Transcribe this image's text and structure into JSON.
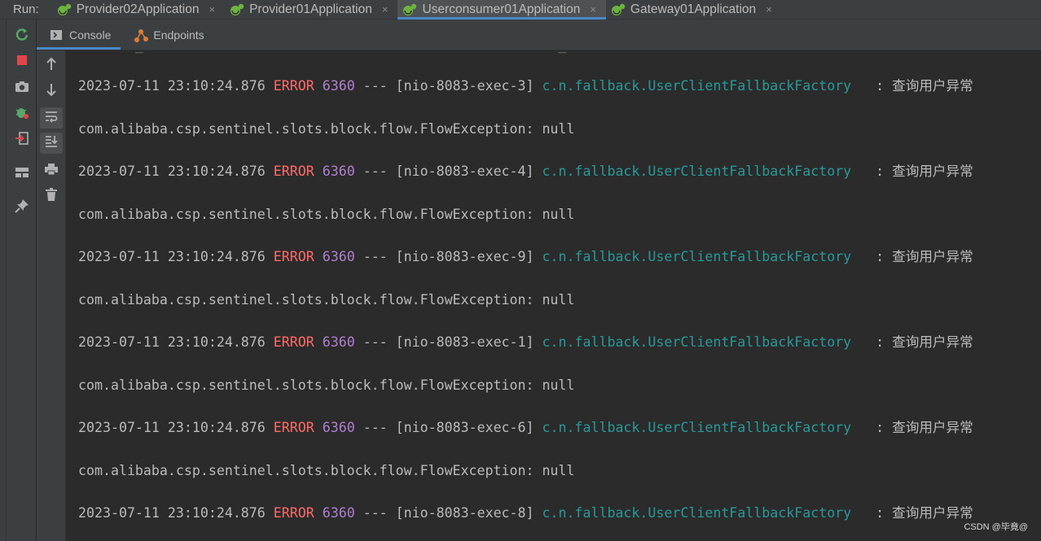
{
  "run_bar": {
    "label": "Run:",
    "tabs": [
      {
        "name": "Provider02Application",
        "active": false
      },
      {
        "name": "Provider01Application",
        "active": false
      },
      {
        "name": "Userconsumer01Application",
        "active": true
      },
      {
        "name": "Gateway01Application",
        "active": false
      }
    ],
    "close_glyph": "×"
  },
  "console_tabs": [
    {
      "label": "Console",
      "icon": "console-icon",
      "active": true
    },
    {
      "label": "Endpoints",
      "icon": "endpoints-icon",
      "active": false
    }
  ],
  "left_toolbar_icons": [
    "rerun-icon",
    "stop-icon",
    "camera-icon",
    "debug-icon",
    "exit-icon",
    "layout-icon",
    "pin-icon"
  ],
  "console_toolbar_icons": [
    "up-arrow-icon",
    "down-arrow-icon",
    "soft-wrap-icon",
    "scroll-to-end-icon",
    "print-icon",
    "trash-icon"
  ],
  "log": {
    "entries": [
      {
        "datetime": "2023-07-11 23:10:24.876",
        "level": "ERROR",
        "pid": "6360",
        "sep": "---",
        "thread": "[nio-8083-exec-3]",
        "logger": "c.n.fallback.UserClientFallbackFactory",
        "message": ": 查询用户异常",
        "exception": "com.alibaba.csp.sentinel.slots.block.flow.FlowException: null"
      },
      {
        "datetime": "2023-07-11 23:10:24.876",
        "level": "ERROR",
        "pid": "6360",
        "sep": "---",
        "thread": "[nio-8083-exec-4]",
        "logger": "c.n.fallback.UserClientFallbackFactory",
        "message": ": 查询用户异常",
        "exception": "com.alibaba.csp.sentinel.slots.block.flow.FlowException: null"
      },
      {
        "datetime": "2023-07-11 23:10:24.876",
        "level": "ERROR",
        "pid": "6360",
        "sep": "---",
        "thread": "[nio-8083-exec-9]",
        "logger": "c.n.fallback.UserClientFallbackFactory",
        "message": ": 查询用户异常",
        "exception": "com.alibaba.csp.sentinel.slots.block.flow.FlowException: null"
      },
      {
        "datetime": "2023-07-11 23:10:24.876",
        "level": "ERROR",
        "pid": "6360",
        "sep": "---",
        "thread": "[nio-8083-exec-1]",
        "logger": "c.n.fallback.UserClientFallbackFactory",
        "message": ": 查询用户异常",
        "exception": "com.alibaba.csp.sentinel.slots.block.flow.FlowException: null"
      },
      {
        "datetime": "2023-07-11 23:10:24.876",
        "level": "ERROR",
        "pid": "6360",
        "sep": "---",
        "thread": "[nio-8083-exec-6]",
        "logger": "c.n.fallback.UserClientFallbackFactory",
        "message": ": 查询用户异常",
        "exception": "com.alibaba.csp.sentinel.slots.block.flow.FlowException: null"
      },
      {
        "datetime": "2023-07-11 23:10:24.876",
        "level": "ERROR",
        "pid": "6360",
        "sep": "---",
        "thread": "[nio-8083-exec-8]",
        "logger": "c.n.fallback.UserClientFallbackFactory",
        "message": ": 查询用户异常",
        "exception": ""
      }
    ]
  },
  "watermark": "CSDN @毕竟@",
  "colors": {
    "error": "#ff6b68",
    "pid": "#b07fcf",
    "logger": "#299999",
    "text": "#bbbbbb",
    "accent": "#4a88c7"
  }
}
